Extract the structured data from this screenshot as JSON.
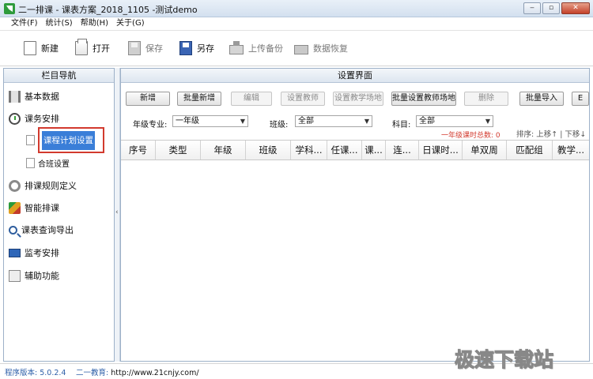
{
  "window": {
    "title": "二一排课 - 课表方案_2018_1105 -测试demo"
  },
  "menu": [
    "文件(F)",
    "统计(S)",
    "帮助(H)",
    "关于(G)"
  ],
  "toolbar": {
    "new_label": "新建",
    "open_label": "打开",
    "save_label": "保存",
    "saveas_label": "另存",
    "upload_label": "上传备份",
    "restore_label": "数据恢复"
  },
  "sidebar": {
    "title": "栏目导航",
    "items": [
      {
        "label": "基本数据",
        "icon": "basic-data-icon"
      },
      {
        "label": "课务安排",
        "icon": "clock-icon"
      },
      {
        "label": "排课规则定义",
        "icon": "gear-icon"
      },
      {
        "label": "智能排课",
        "icon": "smart-schedule-icon"
      },
      {
        "label": "课表查询导出",
        "icon": "search-icon"
      },
      {
        "label": "监考安排",
        "icon": "monitor-icon"
      },
      {
        "label": "辅助功能",
        "icon": "book-icon"
      }
    ],
    "sub_items": [
      {
        "label": "课程计划设置",
        "selected": true
      },
      {
        "label": "合班设置",
        "selected": false
      }
    ]
  },
  "main": {
    "title": "设置界面",
    "buttons": [
      {
        "label": "新增",
        "enabled": true
      },
      {
        "label": "批量新增",
        "enabled": true
      },
      {
        "label": "编辑",
        "enabled": false
      },
      {
        "label": "设置教师",
        "enabled": false
      },
      {
        "label": "设置教学场地",
        "enabled": false
      },
      {
        "label": "批量设置教师场地",
        "enabled": true
      },
      {
        "label": "删除",
        "enabled": false
      },
      {
        "label": "批量导入",
        "enabled": true
      },
      {
        "label": "E",
        "enabled": true
      }
    ],
    "filters": {
      "grade_label": "年级专业:",
      "grade_value": "一年级",
      "class_label": "班级:",
      "class_value": "全部",
      "subject_label": "科目:",
      "subject_value": "全部"
    },
    "total_label": "一年级课时总数: 0",
    "sort_text": "排序: 上移↑ | 下移↓",
    "columns": [
      "序号",
      "类型",
      "年级",
      "班级",
      "学科...",
      "任课...",
      "课...",
      "连...",
      "日课时...",
      "单双周",
      "匹配组",
      "教学..."
    ]
  },
  "status": {
    "version": "程序版本: 5.0.2.4",
    "edu_label": "二一教育:",
    "edu_url": "http://www.21cnjy.com/"
  },
  "watermark": "极速下载站",
  "colors": {
    "selected": "#3a7ed8",
    "highlight_border": "#d23a2e",
    "accent_text": "#2d5fa8"
  }
}
